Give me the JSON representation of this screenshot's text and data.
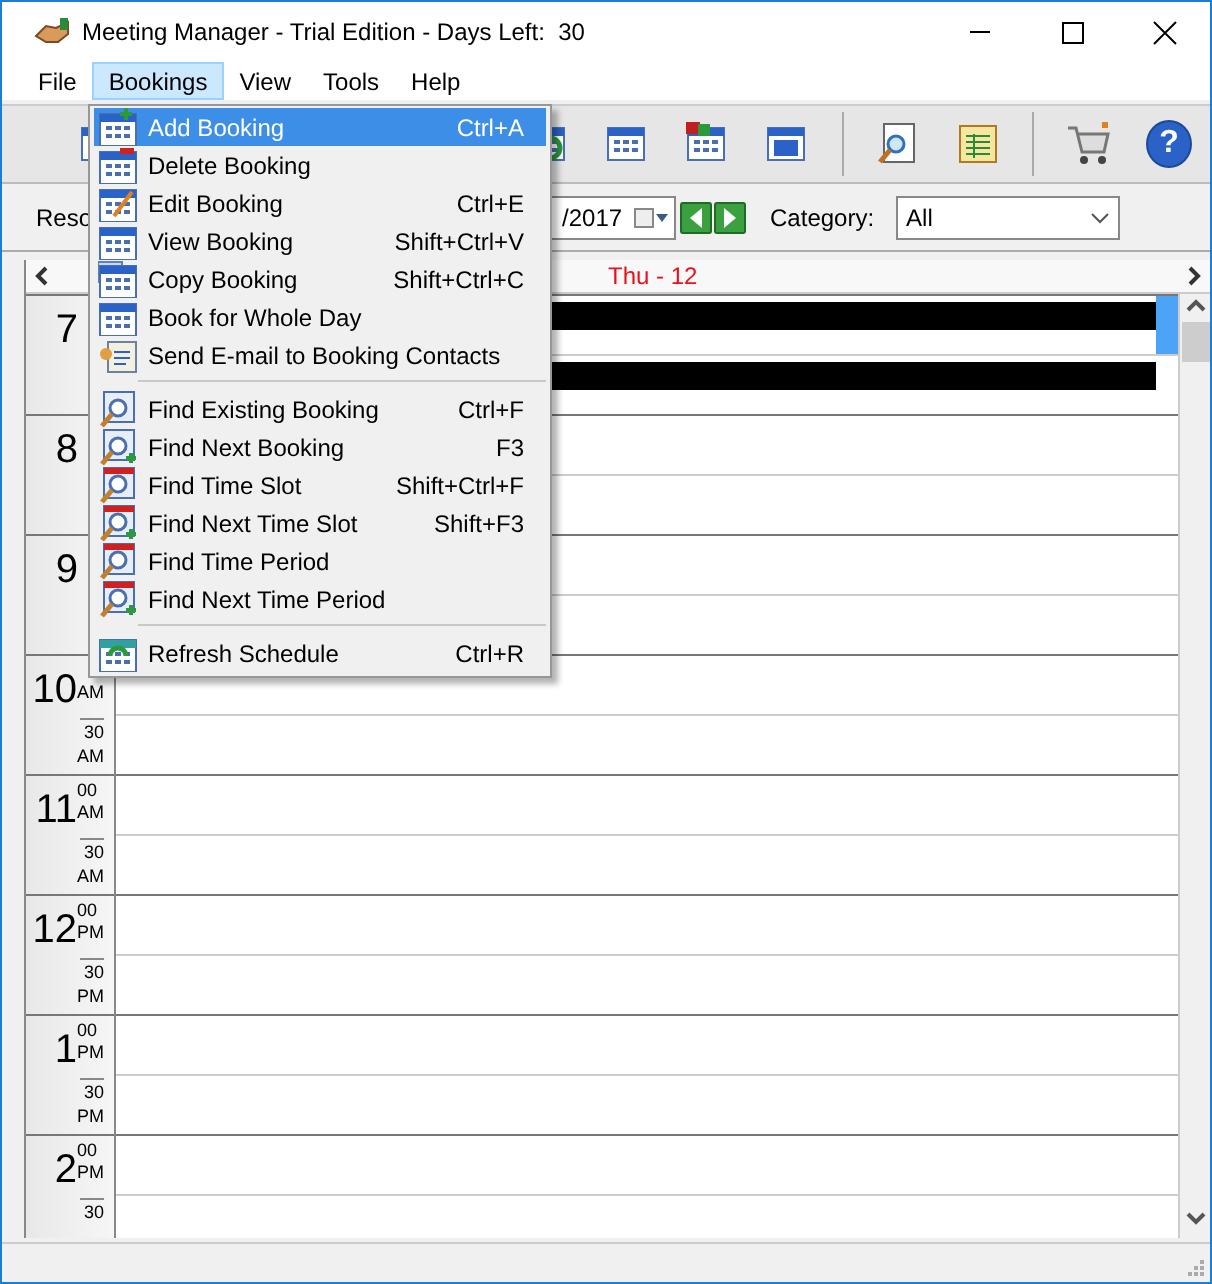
{
  "window": {
    "title": "Meeting Manager - Trial Edition - Days Left:  30"
  },
  "menu_bar": [
    {
      "label": "File",
      "selected": false
    },
    {
      "label": "Bookings",
      "selected": true
    },
    {
      "label": "View",
      "selected": false
    },
    {
      "label": "Tools",
      "selected": false
    },
    {
      "label": "Help",
      "selected": false
    }
  ],
  "bookings_menu": [
    {
      "kind": "item",
      "label": "Add Booking",
      "shortcut": "Ctrl+A",
      "selected": true
    },
    {
      "kind": "item",
      "label": "Delete Booking",
      "selected": false
    },
    {
      "kind": "item",
      "label": "Edit Booking",
      "shortcut": "Ctrl+E",
      "selected": false
    },
    {
      "kind": "item",
      "label": "View Booking",
      "shortcut": "Shift+Ctrl+V",
      "selected": false
    },
    {
      "kind": "item",
      "label": "Copy Booking",
      "shortcut": "Shift+Ctrl+C",
      "selected": false
    },
    {
      "kind": "item",
      "label": "Book for Whole Day",
      "selected": false
    },
    {
      "kind": "item",
      "label": "Send E-mail to Booking Contacts",
      "selected": false
    },
    {
      "kind": "separator"
    },
    {
      "kind": "item",
      "label": "Find Existing Booking",
      "shortcut": "Ctrl+F",
      "selected": false
    },
    {
      "kind": "item",
      "label": "Find Next Booking",
      "shortcut": "F3",
      "selected": false
    },
    {
      "kind": "item",
      "label": "Find Time Slot",
      "shortcut": "Shift+Ctrl+F",
      "selected": false
    },
    {
      "kind": "item",
      "label": "Find Next Time Slot",
      "shortcut": "Shift+F3",
      "selected": false
    },
    {
      "kind": "item",
      "label": "Find Time Period",
      "selected": false
    },
    {
      "kind": "item",
      "label": "Find Next Time Period",
      "selected": false
    },
    {
      "kind": "separator"
    },
    {
      "kind": "item",
      "label": "Refresh Schedule",
      "shortcut": "Ctrl+R",
      "selected": false
    }
  ],
  "toolbar": {
    "help": "?"
  },
  "filter_bar": {
    "label": "Reso",
    "date": "/2017",
    "category_label": "Category:",
    "category": "All"
  },
  "schedule": {
    "day": "Thu - 12",
    "rows": [
      {
        "hour": "7",
        "slots": [
          {
            "booked": true,
            "selected": true
          },
          {
            "booked": true,
            "selected": false
          }
        ]
      },
      {
        "hour": "8",
        "slots": [
          {
            "booked": false,
            "selected": false
          },
          {
            "booked": false,
            "selected": false
          }
        ]
      },
      {
        "hour": "9",
        "slots": [
          {
            "booked": false,
            "selected": false
          },
          {
            "booked": false,
            "selected": false
          }
        ]
      },
      {
        "hour": "10",
        "suffix": "AM",
        "half": "30",
        "half_suffix": "AM",
        "slots": [
          {
            "booked": false,
            "selected": false
          },
          {
            "booked": false,
            "selected": false
          }
        ]
      },
      {
        "hour": "11",
        "minute": "00",
        "suffix": "AM",
        "half": "30",
        "half_suffix": "AM",
        "slots": [
          {
            "booked": false,
            "selected": false
          },
          {
            "booked": false,
            "selected": false
          }
        ]
      },
      {
        "hour": "12",
        "minute": "00",
        "suffix": "PM",
        "half": "30",
        "half_suffix": "PM",
        "slots": [
          {
            "booked": false,
            "selected": false
          },
          {
            "booked": false,
            "selected": false
          }
        ]
      },
      {
        "hour": "1",
        "minute": "00",
        "suffix": "PM",
        "half": "30",
        "half_suffix": "PM",
        "slots": [
          {
            "booked": false,
            "selected": false
          },
          {
            "booked": false,
            "selected": false
          }
        ]
      },
      {
        "hour": "2",
        "minute": "00",
        "suffix": "PM",
        "half": "30",
        "slots": [
          {
            "booked": false,
            "selected": false
          },
          {
            "booked": false,
            "selected": false
          }
        ]
      }
    ]
  }
}
